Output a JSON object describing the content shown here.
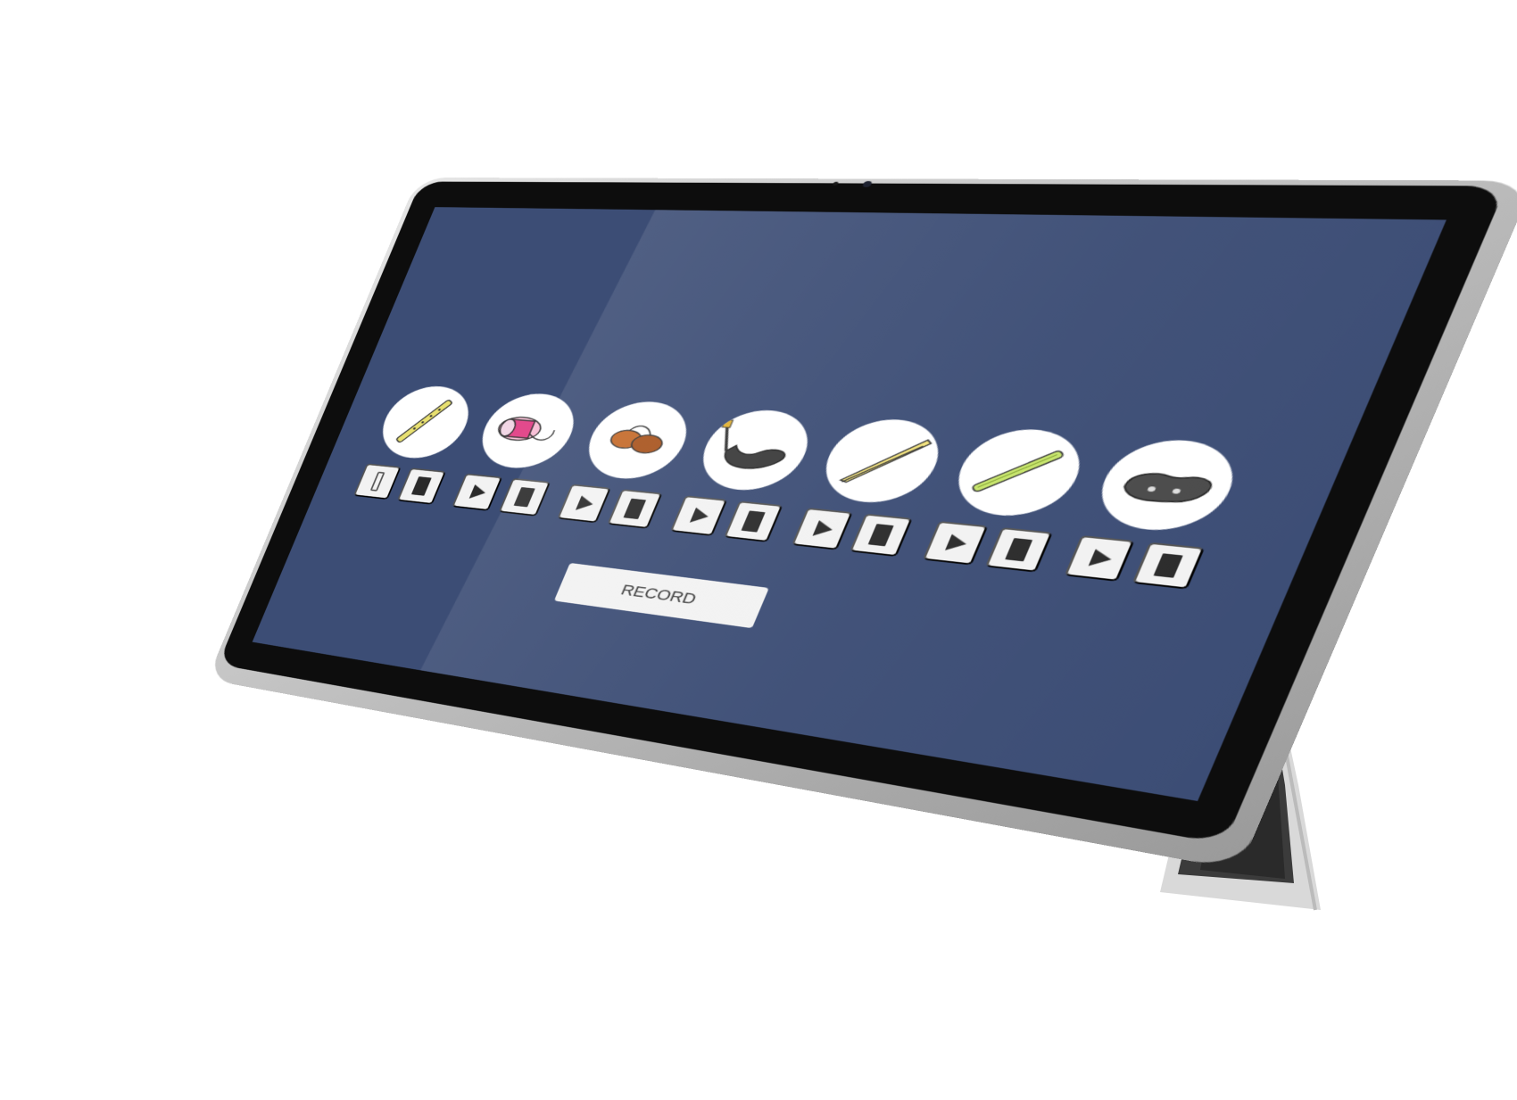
{
  "colors": {
    "screen_background": "#3c4d75",
    "tile_background": "#ffffff",
    "control_background": "#f2f2f2",
    "control_glyph": "#2a2a2a"
  },
  "items": [
    {
      "image": "flute-icon",
      "play_state": "paused",
      "play_icon": "pause-icon",
      "stop_icon": "stop-icon"
    },
    {
      "image": "bandage-roll-icon",
      "play_state": "ready",
      "play_icon": "play-icon",
      "stop_icon": "stop-icon"
    },
    {
      "image": "castanets-icon",
      "play_state": "ready",
      "play_icon": "play-icon",
      "stop_icon": "stop-icon"
    },
    {
      "image": "bagpipe-icon",
      "play_state": "ready",
      "play_icon": "play-icon",
      "stop_icon": "stop-icon"
    },
    {
      "image": "tweezers-icon",
      "play_state": "ready",
      "play_icon": "play-icon",
      "stop_icon": "stop-icon"
    },
    {
      "image": "recorder-icon",
      "play_state": "ready",
      "play_icon": "play-icon",
      "stop_icon": "stop-icon"
    },
    {
      "image": "ocarina-icon",
      "play_state": "ready",
      "play_icon": "play-icon",
      "stop_icon": "stop-icon"
    }
  ],
  "record": {
    "label": "RECORD"
  }
}
